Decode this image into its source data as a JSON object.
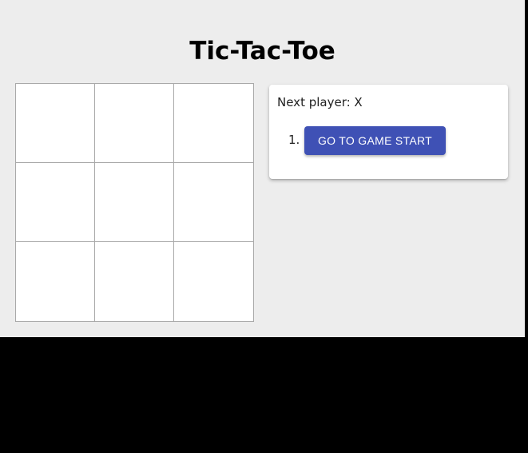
{
  "game": {
    "title": "Tic-Tac-Toe",
    "board": [
      "",
      "",
      "",
      "",
      "",
      "",
      "",
      "",
      ""
    ],
    "status": "Next player: X"
  },
  "history": {
    "moves": [
      {
        "number": "1.",
        "label": "GO TO GAME START"
      }
    ]
  },
  "colors": {
    "background": "#ededed",
    "board_border": "#a9a9a9",
    "button": "#3f51b5",
    "button_text": "#ffffff"
  }
}
